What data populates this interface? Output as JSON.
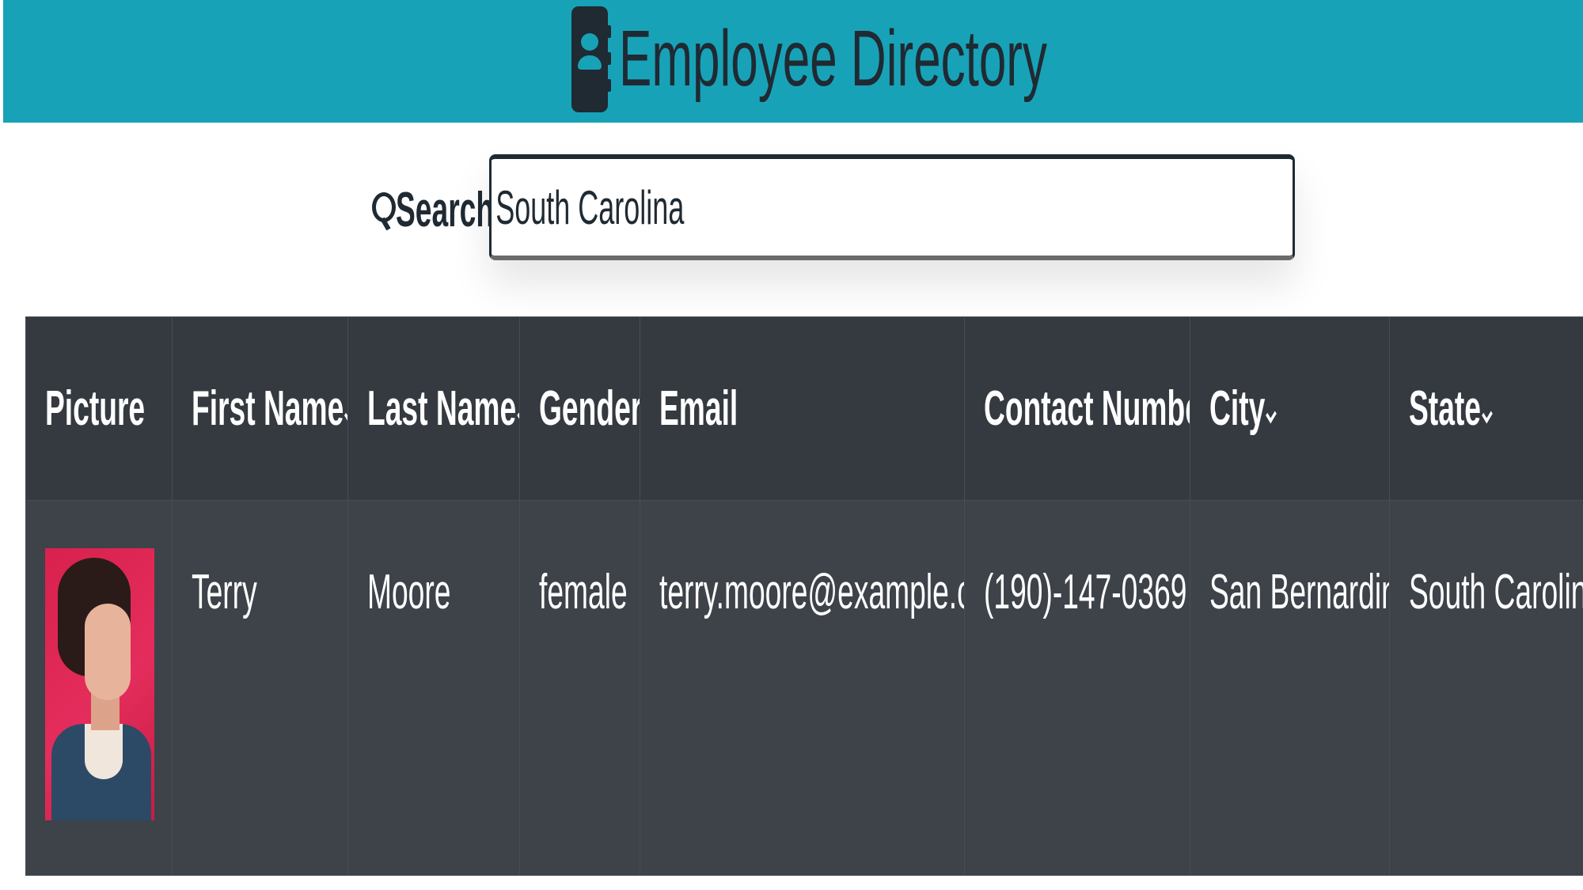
{
  "header": {
    "title": "Employee Directory",
    "icon": "address-book-icon",
    "background": "#18a2b7"
  },
  "search": {
    "label": "Search:",
    "value": "South Carolina",
    "icon": "search-icon"
  },
  "table": {
    "columns": [
      {
        "label": "Picture",
        "sortable": false
      },
      {
        "label": "First Name",
        "sortable": true
      },
      {
        "label": "Last Name",
        "sortable": true
      },
      {
        "label": "Gender",
        "sortable": false
      },
      {
        "label": "Email",
        "sortable": false
      },
      {
        "label": "Contact Number",
        "sortable": false
      },
      {
        "label": "City",
        "sortable": true
      },
      {
        "label": "State",
        "sortable": true
      }
    ],
    "rows": [
      {
        "picture": "employee-photo",
        "first_name": "Terry",
        "last_name": "Moore",
        "gender": "female",
        "email": "terry.moore@example.com",
        "phone": "(190)-147-0369",
        "city": "San Bernardino",
        "state": "South Carolina"
      }
    ]
  },
  "colors": {
    "table_header": "#343a40",
    "table_row": "#3e434a",
    "text_dark": "#1f2a33"
  }
}
